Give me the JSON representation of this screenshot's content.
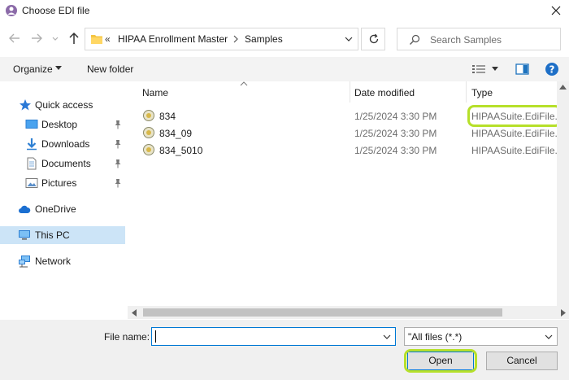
{
  "window": {
    "title": "Choose EDI file"
  },
  "address": {
    "prefix": "«",
    "crumbs": [
      "HIPAA Enrollment Master",
      "Samples"
    ]
  },
  "search": {
    "placeholder": "Search Samples"
  },
  "toolbar": {
    "organize": "Organize",
    "new_folder": "New folder"
  },
  "nav": {
    "quick_access": "Quick access",
    "items": [
      "Desktop",
      "Downloads",
      "Documents",
      "Pictures"
    ],
    "onedrive": "OneDrive",
    "this_pc": "This PC",
    "network": "Network"
  },
  "columns": {
    "name": "Name",
    "date": "Date modified",
    "type": "Type"
  },
  "files": [
    {
      "name": "834",
      "date": "1/25/2024 3:30 PM",
      "type": "HIPAASuite.EdiFile..."
    },
    {
      "name": "834_09",
      "date": "1/25/2024 3:30 PM",
      "type": "HIPAASuite.EdiFile..."
    },
    {
      "name": "834_5010",
      "date": "1/25/2024 3:30 PM",
      "type": "HIPAASuite.EdiFile..."
    }
  ],
  "bottom": {
    "file_name_label": "File name:",
    "file_name_value": "",
    "filter": "\"All files (*.*)",
    "open": "Open",
    "cancel": "Cancel"
  },
  "colors": {
    "accent": "#0078d4",
    "highlight": "#b6e02a",
    "selected": "#cce4f7"
  }
}
